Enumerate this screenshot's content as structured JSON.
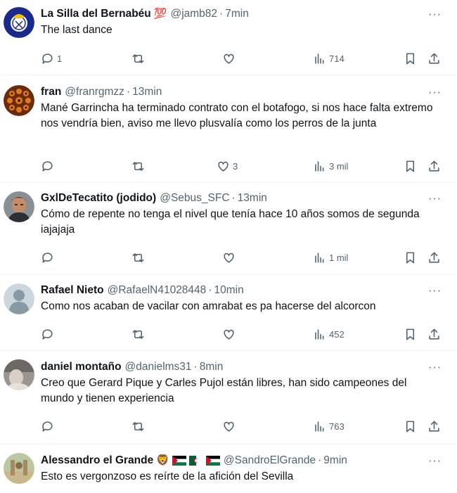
{
  "tweets": [
    {
      "name": "La Silla del Bernabéu",
      "name_emoji": "💯",
      "handle": "@jamb82",
      "time": "7min",
      "text": "The last dance",
      "replies": "1",
      "retweets": "",
      "likes": "",
      "views": "714"
    },
    {
      "name": "fran",
      "handle": "@franrgmzz",
      "time": "13min",
      "text": "Mané Garrincha ha terminado contrato con el botafogo, si nos hace falta extremo nos vendría bien, aviso me llevo plusvalía como los perros de la junta",
      "replies": "",
      "retweets": "",
      "likes": "3",
      "views": "3 mil"
    },
    {
      "name": "GxlDeTecatito (jodido)",
      "handle": "@Sebus_SFC",
      "time": "13min",
      "text": "Cómo de repente no tenga el nivel que tenía hace 10 años somos de segunda iajajaja",
      "replies": "",
      "retweets": "",
      "likes": "",
      "views": "1 mil"
    },
    {
      "name": "Rafael Nieto",
      "handle": "@RafaelN41028448",
      "time": "10min",
      "text": "Como nos acaban de vacilar con amrabat es pa hacerse del alcorcon",
      "replies": "",
      "retweets": "",
      "likes": "",
      "views": "452"
    },
    {
      "name": "daniel montaño",
      "handle": "@danielms31",
      "time": "8min",
      "text": "Creo que Gerard Pique y Carles Pujol están libres, han sido campeones del mundo y tienen experiencia",
      "replies": "",
      "retweets": "",
      "likes": "",
      "views": "763"
    },
    {
      "name": "Alessandro el Grande",
      "name_emoji": "🦁",
      "handle": "@SandroElGrande",
      "time": "9min",
      "text": "Esto es vergonzoso es reírte de la afición del Sevilla"
    }
  ],
  "separator": "·",
  "more_glyph": "···",
  "colors": {
    "text": "#0f1419",
    "secondary": "#536471",
    "divider": "#eff3f4",
    "flag_green": "#007a3d",
    "flag_red": "#d21034"
  },
  "icons": [
    "reply-icon",
    "retweet-icon",
    "like-icon",
    "views-icon",
    "bookmark-icon",
    "share-icon",
    "more-icon"
  ]
}
